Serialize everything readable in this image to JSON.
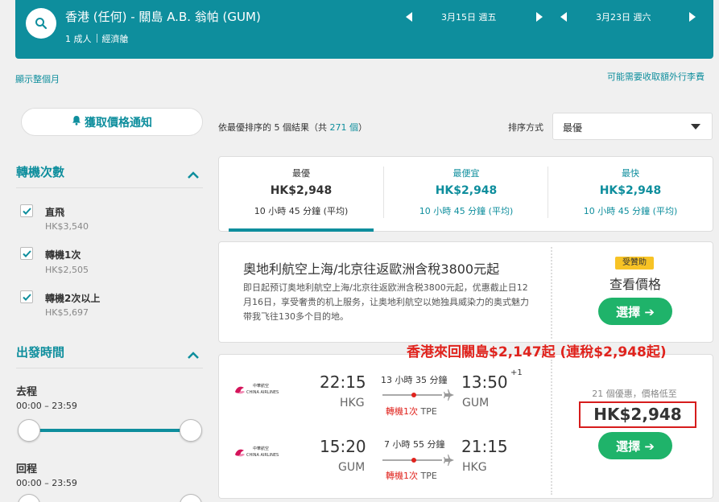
{
  "header": {
    "route_title": "香港 (任何) - 關島 A.B. 翁帕 (GUM)",
    "passengers": "1 成人",
    "cabin": "經濟艙",
    "depart_date": "3月15日 週五",
    "return_date": "3月23日 週六"
  },
  "links": {
    "show_month": "顯示整個月",
    "baggage_fee": "可能需要收取額外行李費"
  },
  "sidebar": {
    "price_alert": "獲取價格通知",
    "stops_title": "轉機次數",
    "stops": [
      {
        "label": "直飛",
        "price": "HK$3,540",
        "checked": true
      },
      {
        "label": "轉機1次",
        "price": "HK$2,505",
        "checked": true
      },
      {
        "label": "轉機2次以上",
        "price": "HK$5,697",
        "checked": true
      }
    ],
    "times_title": "出發時間",
    "outbound_label": "去程",
    "outbound_range": "00:00 – 23:59",
    "return_label": "回程",
    "return_range": "00:00 – 23:59"
  },
  "results": {
    "summary_prefix": "依最優排序的 ",
    "count": "5",
    "summary_mid": " 個結果（共 ",
    "total": "271 個",
    "summary_suffix": "）",
    "sort_label": "排序方式",
    "sort_value": "最優"
  },
  "tabs": [
    {
      "name": "最優",
      "price": "HK$2,948",
      "duration": "10 小時 45 分鐘 (平均)"
    },
    {
      "name": "最便宜",
      "price": "HK$2,948",
      "duration": "10 小時 45 分鐘 (平均)"
    },
    {
      "name": "最快",
      "price": "HK$2,948",
      "duration": "10 小時 45 分鐘 (平均)"
    }
  ],
  "ad": {
    "title": "奧地利航空上海/北京往返歐洲含稅3800元起",
    "body": "即日起预订奥地利航空上海/北京往返欧洲含税3800元起，优惠截止日12月16日，享受奢贵的机上服务，让奥地利航空以她独具威染力的奥式魅力带我飞往130多个目的地。",
    "badge": "受贊助",
    "view_price": "查看價格",
    "select": "選擇 ➔"
  },
  "promo": "香港來回關島$2,147起 (連稅$2,948起)",
  "flight": {
    "airline_cn": "中華航空",
    "airline_en": "CHINA AIRLINES",
    "outbound": {
      "dep_time": "22:15",
      "dep_code": "HKG",
      "duration": "13 小時 35 分鐘",
      "stops": "轉機1次",
      "via": "TPE",
      "arr_time": "13:50",
      "arr_code": "GUM",
      "plus_day": "+1"
    },
    "inbound": {
      "dep_time": "15:20",
      "dep_code": "GUM",
      "duration": "7 小時 55 分鐘",
      "stops": "轉機1次",
      "via": "TPE",
      "arr_time": "21:15",
      "arr_code": "HKG"
    },
    "deals": "21 個優惠，價格低至",
    "price": "HK$2,948",
    "select": "選擇 ➔"
  },
  "colors": {
    "brand": "#0e8e9d",
    "accent_green": "#1fb36a",
    "promo_red": "#e0231d"
  }
}
